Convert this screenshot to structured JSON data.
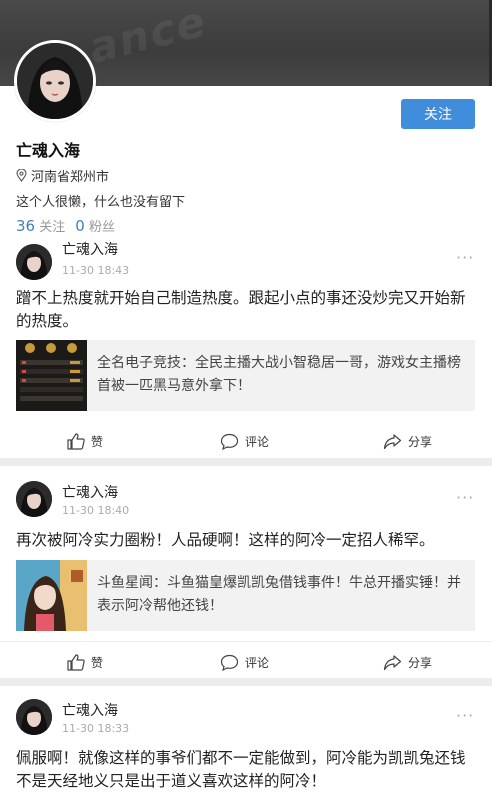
{
  "profile": {
    "name": "亡魂入海",
    "location": "河南省郑州市",
    "bio": "这个人很懒，什么也没有留下",
    "following_count": "36",
    "following_label": "关注",
    "followers_count": "0",
    "followers_label": "粉丝",
    "follow_button": "关注",
    "cover_watermark": "ance"
  },
  "actions": {
    "like": "赞",
    "comment": "评论",
    "share": "分享",
    "more": "···"
  },
  "posts": [
    {
      "author": "亡魂入海",
      "time": "11-30 18:43",
      "text": "蹭不上热度就开始自己制造热度。跟起小点的事还没炒完又开始新的热度。",
      "card": "全名电子竞技：全民主播大战小智稳居一哥，游戏女主播榜首被一匹黑马意外拿下！"
    },
    {
      "author": "亡魂入海",
      "time": "11-30 18:40",
      "text": "再次被阿冷实力圈粉！人品硬啊！这样的阿冷一定招人稀罕。",
      "card": "斗鱼星闻：斗鱼猫皇爆凯凯兔借钱事件！牛总开播实锤！并表示阿冷帮他还钱！"
    },
    {
      "author": "亡魂入海",
      "time": "11-30 18:33",
      "text": "佩服啊！就像这样的事爷们都不一定能做到，阿冷能为凯凯兔还钱不是天经地义只是出于道义喜欢这样的阿冷！"
    }
  ],
  "colors": {
    "accent": "#3f8ddb",
    "link": "#3f7fbf"
  }
}
